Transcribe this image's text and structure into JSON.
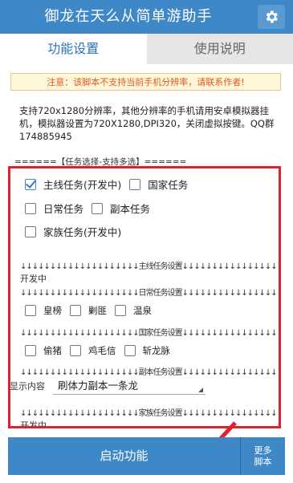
{
  "app": {
    "title": "御龙在天么从简单游助手",
    "settings_icon": "gear-icon"
  },
  "tabs": [
    {
      "label": "功能设置",
      "active": true
    },
    {
      "label": "使用说明",
      "active": false
    }
  ],
  "notice": "注意：该脚本不支持当前手机分辨率，请联系作者!",
  "support_text": "支持720x1280分辨率，其他分辨率的手机请用安卓模拟器挂机，模拟器设置为720X1280,DPI320，关闭虚拟按键。QQ群174885945",
  "section_title": "======【任务选择-支持多选】======",
  "tasks": [
    {
      "label": "主线任务(开发中)",
      "checked": true
    },
    {
      "label": "国家任务",
      "checked": false
    },
    {
      "label": "日常任务",
      "checked": false
    },
    {
      "label": "副本任务",
      "checked": false
    },
    {
      "label": "家族任务(开发中)",
      "checked": false
    }
  ],
  "dividers": {
    "main": "↓↓↓↓↓↓↓↓↓↓↓↓↓↓↓↓↓↓↓↓主线任务设置↓↓↓↓↓↓↓↓↓↓↓↓↓↓↓↓↓↓↓↓",
    "daily": "↓↓↓↓↓↓↓↓↓↓↓↓↓↓↓↓↓↓↓↓日常任务设置↓↓↓↓↓↓↓↓↓↓↓↓↓↓↓↓↓↓↓↓",
    "country": "↓↓↓↓↓↓↓↓↓↓↓↓↓↓↓↓↓↓↓↓国家任务设置↓↓↓↓↓↓↓↓↓↓↓↓↓↓↓↓↓↓↓↓",
    "dungeon": "↓↓↓↓↓↓↓↓↓↓↓↓↓↓↓↓↓↓↓↓副本任务设置↓↓↓↓↓↓↓↓↓↓↓↓↓↓↓↓↓↓↓↓",
    "family": "↓↓↓↓↓↓↓↓↓↓↓↓↓↓↓↓↓↓↓↓家族任务设置↓↓↓↓↓↓↓↓↓↓↓↓↓↓↓↓↓↓↓↓"
  },
  "in_development": "开发中",
  "in_development_2": "开发中",
  "daily_options": [
    {
      "label": "皇榜",
      "checked": false
    },
    {
      "label": "剿匪",
      "checked": false
    },
    {
      "label": "温泉",
      "checked": false
    }
  ],
  "country_options": [
    {
      "label": "偷猪",
      "checked": false
    },
    {
      "label": "鸡毛信",
      "checked": false
    },
    {
      "label": "斩龙脉",
      "checked": false
    }
  ],
  "display": {
    "label": "显示内容",
    "selected": "刷体力副本一条龙"
  },
  "buttons": {
    "start": "启动功能",
    "more_line1": "更多",
    "more_line2": "脚本"
  },
  "colors": {
    "primary": "#3f88c8",
    "highlight_border": "#e0212b",
    "notice_text": "#e05a24"
  }
}
